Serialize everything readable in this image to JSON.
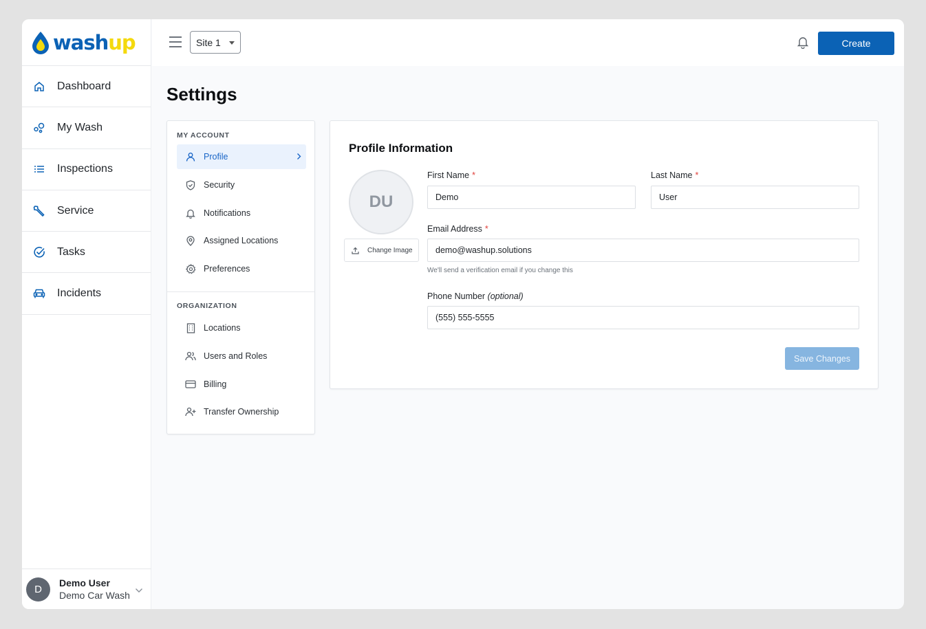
{
  "brand": {
    "logo_wash": "wash",
    "logo_up": "up",
    "primary": "#0b62b5",
    "accent": "#f4d90d"
  },
  "sidebar": {
    "items": [
      {
        "label": "Dashboard",
        "icon": "home-icon"
      },
      {
        "label": "My Wash",
        "icon": "bubbles-icon"
      },
      {
        "label": "Inspections",
        "icon": "list-icon"
      },
      {
        "label": "Service",
        "icon": "wrench-icon"
      },
      {
        "label": "Tasks",
        "icon": "check-circle-icon"
      },
      {
        "label": "Incidents",
        "icon": "car-icon"
      }
    ],
    "user": {
      "initial": "D",
      "name": "Demo User",
      "org": "Demo Car Wash"
    }
  },
  "topbar": {
    "site": "Site 1",
    "create_label": "Create"
  },
  "page": {
    "title": "Settings"
  },
  "settings_menu": {
    "my_account_heading": "MY ACCOUNT",
    "my_account": [
      {
        "label": "Profile",
        "icon": "user-icon",
        "active": true
      },
      {
        "label": "Security",
        "icon": "shield-icon"
      },
      {
        "label": "Notifications",
        "icon": "bell-icon"
      },
      {
        "label": "Assigned Locations",
        "icon": "map-pin-icon"
      },
      {
        "label": "Preferences",
        "icon": "gear-icon"
      }
    ],
    "organization_heading": "ORGANIZATION",
    "organization": [
      {
        "label": "Locations",
        "icon": "building-icon"
      },
      {
        "label": "Users and Roles",
        "icon": "users-icon"
      },
      {
        "label": "Billing",
        "icon": "credit-card-icon"
      },
      {
        "label": "Transfer Ownership",
        "icon": "user-plus-icon"
      }
    ]
  },
  "profile": {
    "title": "Profile Information",
    "avatar_initials": "DU",
    "change_image_label": "Change Image",
    "first_name_label": "First Name",
    "first_name": "Demo",
    "last_name_label": "Last Name",
    "last_name": "User",
    "required_mark": "*",
    "email_label": "Email Address",
    "email": "demo@washup.solutions",
    "email_helper": "We'll send a verification email if you change this",
    "phone_label": "Phone Number",
    "phone_optional": "(optional)",
    "phone": "(555) 555-5555",
    "save_label": "Save Changes"
  }
}
